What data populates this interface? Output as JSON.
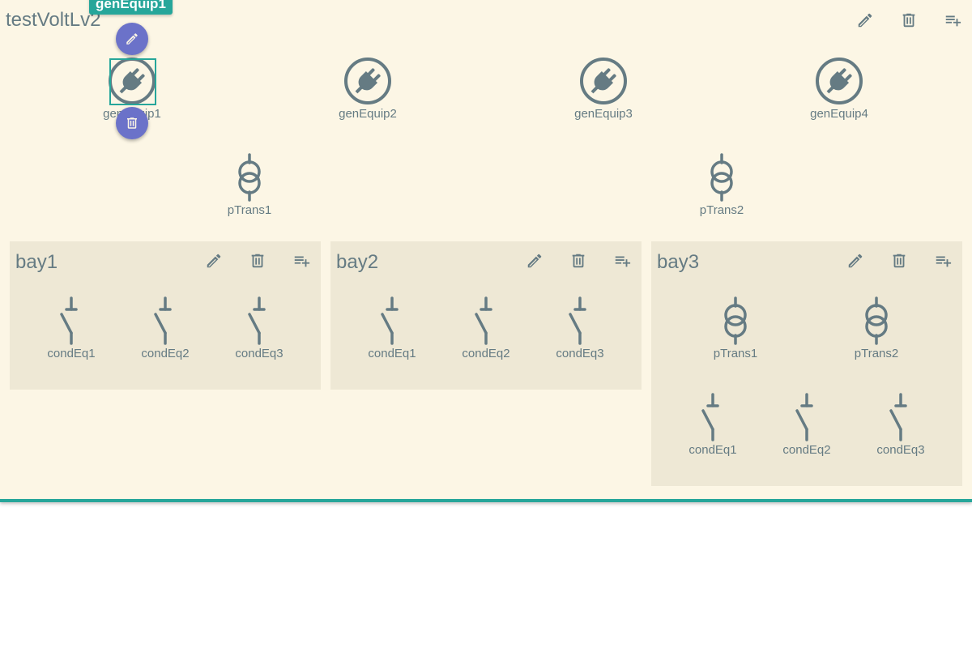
{
  "voltage_level": {
    "title": "testVoltLv2",
    "toolbar": {
      "edit_icon": "pencil-icon",
      "delete_icon": "trash-icon",
      "add_icon": "playlist-plus-icon"
    },
    "generators": [
      {
        "label": "genEquip1",
        "icon": "plug-icon",
        "selected": true
      },
      {
        "label": "genEquip2",
        "icon": "plug-icon"
      },
      {
        "label": "genEquip3",
        "icon": "plug-icon"
      },
      {
        "label": "genEquip4",
        "icon": "plug-icon"
      }
    ],
    "transformers": [
      {
        "label": "pTrans1",
        "icon": "transformer-icon"
      },
      {
        "label": "pTrans2",
        "icon": "transformer-icon"
      }
    ]
  },
  "selection": {
    "tooltip": "genEquip1",
    "edit_icon": "pencil-icon",
    "delete_icon": "trash-icon"
  },
  "bays": [
    {
      "title": "bay1",
      "transformers": [],
      "equipment": [
        "condEq1",
        "condEq2",
        "condEq3"
      ]
    },
    {
      "title": "bay2",
      "transformers": [],
      "equipment": [
        "condEq1",
        "condEq2",
        "condEq3"
      ]
    },
    {
      "title": "bay3",
      "transformers": [
        "pTrans1",
        "pTrans2"
      ],
      "equipment": [
        "condEq1",
        "condEq2",
        "condEq3"
      ]
    }
  ],
  "colors": {
    "background": "#fcf6e5",
    "bay_background": "#eee8d5",
    "accent": "#26a69a",
    "icon": "#657b83",
    "fab": "#6b72c9"
  }
}
